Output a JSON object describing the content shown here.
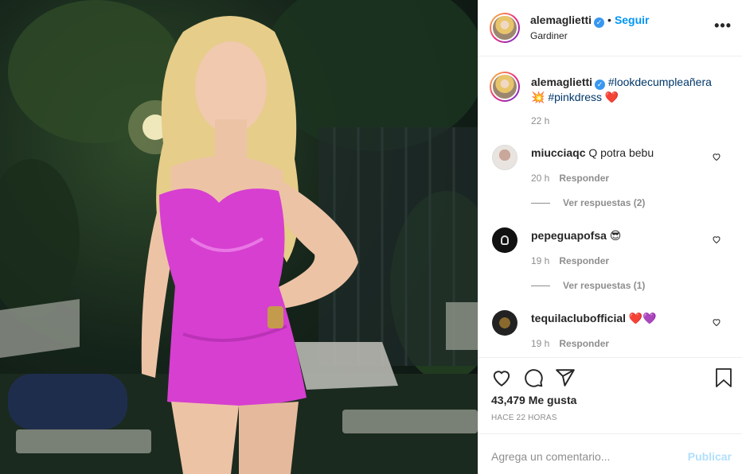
{
  "post": {
    "author": "alemaglietti",
    "follow_label": "Seguir",
    "location": "Gardiner",
    "caption_hashtags": [
      "#lookdecumpleañera",
      "#pinkdress"
    ],
    "caption_emoji_start": "💥",
    "caption_emoji_end": "❤️",
    "caption_time": "22 h"
  },
  "comments": [
    {
      "user": "miucciaqc",
      "text": "Q potra bebu",
      "time": "20 h",
      "reply_label": "Responder",
      "view_replies": "Ver respuestas (2)"
    },
    {
      "user": "pepeguapofsa",
      "text": "😎",
      "time": "19 h",
      "reply_label": "Responder",
      "view_replies": "Ver respuestas (1)"
    },
    {
      "user": "tequilaclubofficial",
      "text": "❤️💜",
      "time": "19 h",
      "reply_label": "Responder"
    }
  ],
  "likes": "43,479 Me gusta",
  "posted_ago": "HACE 22 HORAS",
  "comment_box": {
    "placeholder": "Agrega un comentario...",
    "publish_label": "Publicar"
  },
  "colors": {
    "link_blue": "#0095f6",
    "hashtag": "#00376b",
    "muted": "#8e8e8e",
    "dress_pink": "#d63fd0"
  },
  "icons": [
    "heart-icon",
    "comment-icon",
    "share-icon",
    "bookmark-icon",
    "more-options-icon",
    "verified-badge-icon"
  ]
}
